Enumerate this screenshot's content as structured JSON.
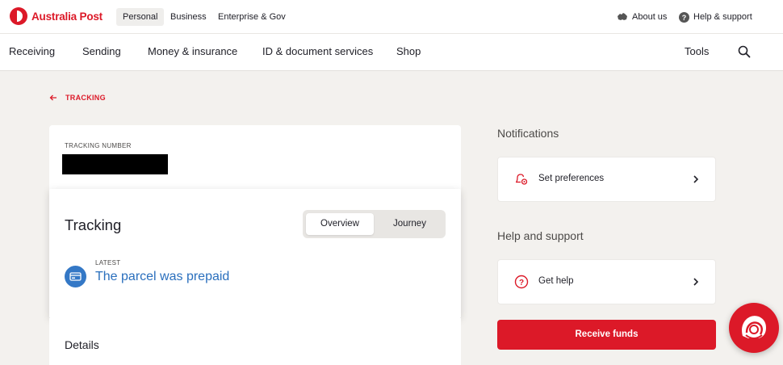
{
  "brand": {
    "name": "Australia Post",
    "color": "#dc1928"
  },
  "topbar": {
    "segments": [
      "Personal",
      "Business",
      "Enterprise & Gov"
    ],
    "active_segment": "Personal",
    "about_label": "About us",
    "help_label": "Help & support",
    "about_icon": "australia-map-icon",
    "help_icon": "question-circle-icon"
  },
  "mainnav": {
    "items": [
      "Receiving",
      "Sending",
      "Money & insurance",
      "ID & document services",
      "Shop"
    ],
    "tools_label": "Tools",
    "search_icon": "search-icon"
  },
  "breadcrumb": {
    "label": "TRACKING",
    "icon": "back-arrow-icon"
  },
  "tracking_number": {
    "label": "TRACKING NUMBER",
    "value_redacted": true
  },
  "tracking": {
    "title": "Tracking",
    "tabs": [
      "Overview",
      "Journey"
    ],
    "active_tab": "Overview",
    "latest_label": "LATEST",
    "latest_status": "The parcel was prepaid",
    "latest_icon": "prepaid-card-icon",
    "accent_color": "#2a6fbd"
  },
  "details": {
    "title": "Details"
  },
  "notifications": {
    "heading": "Notifications",
    "card_label": "Set preferences",
    "card_icon": "bell-gear-icon"
  },
  "help": {
    "heading": "Help and support",
    "card_label": "Get help",
    "card_icon": "question-circle-icon"
  },
  "receive_button": {
    "label": "Receive funds"
  },
  "chat": {
    "icon": "chat-assistant-icon"
  }
}
